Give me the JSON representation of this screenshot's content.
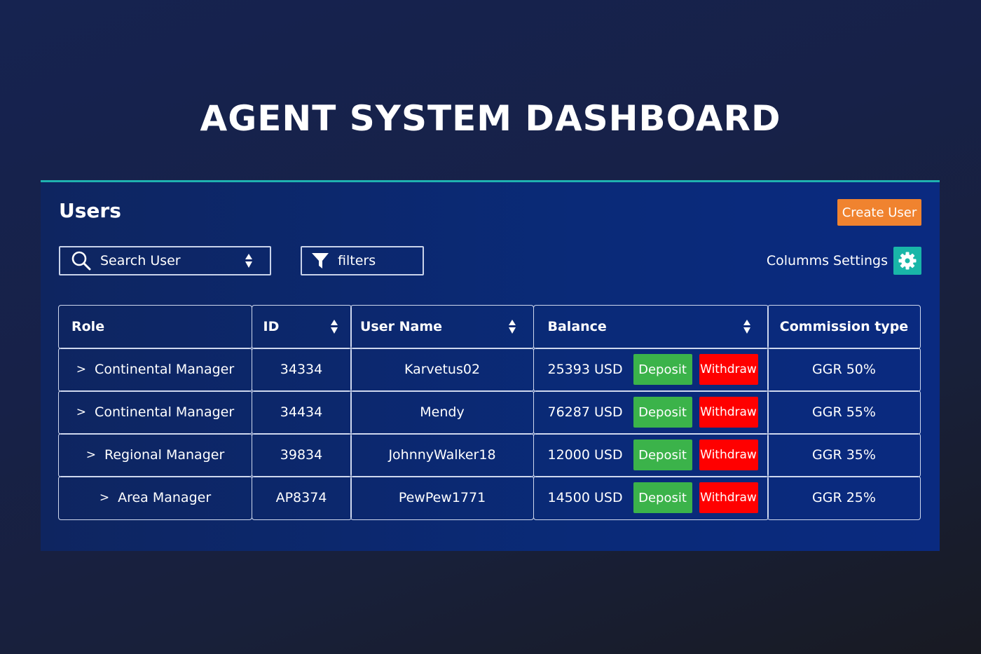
{
  "page": {
    "title": "AGENT SYSTEM DASHBOARD"
  },
  "colors": {
    "accent_bar": "#1fb2b0",
    "create_button": "#f0832f",
    "settings_button": "#19b6a8",
    "deposit": "#3bb34a",
    "withdraw": "#ff0000"
  },
  "panel": {
    "title": "Users",
    "create_button_label": "Create User",
    "search": {
      "placeholder": "Search User",
      "icon": "search-icon",
      "sort_icon": "sort-icon"
    },
    "filters": {
      "label": "filters",
      "icon": "filter-icon"
    },
    "columns_settings": {
      "label": "Columms Settings",
      "icon": "gear-icon"
    }
  },
  "table": {
    "headers": [
      {
        "label": "Role",
        "sortable": false
      },
      {
        "label": "ID",
        "sortable": true
      },
      {
        "label": "User Name",
        "sortable": true
      },
      {
        "label": "Balance",
        "sortable": true
      },
      {
        "label": "Commission type",
        "sortable": false
      }
    ],
    "deposit_label": "Deposit",
    "withdraw_label": "Withdraw",
    "rows": [
      {
        "expand": ">",
        "role": "Continental Manager",
        "id": "34334",
        "username": "Karvetus02",
        "balance": "25393 USD",
        "commission": "GGR 50%"
      },
      {
        "expand": ">",
        "role": "Continental Manager",
        "id": "34434",
        "username": "Mendy",
        "balance": "76287 USD",
        "commission": "GGR 55%"
      },
      {
        "expand": ">",
        "role": "Regional Manager",
        "id": "39834",
        "username": "JohnnyWalker18",
        "balance": "12000 USD",
        "commission": "GGR 35%"
      },
      {
        "expand": ">",
        "role": "Area Manager",
        "id": "AP8374",
        "username": "PewPew1771",
        "balance": "14500 USD",
        "commission": "GGR 25%"
      }
    ]
  }
}
